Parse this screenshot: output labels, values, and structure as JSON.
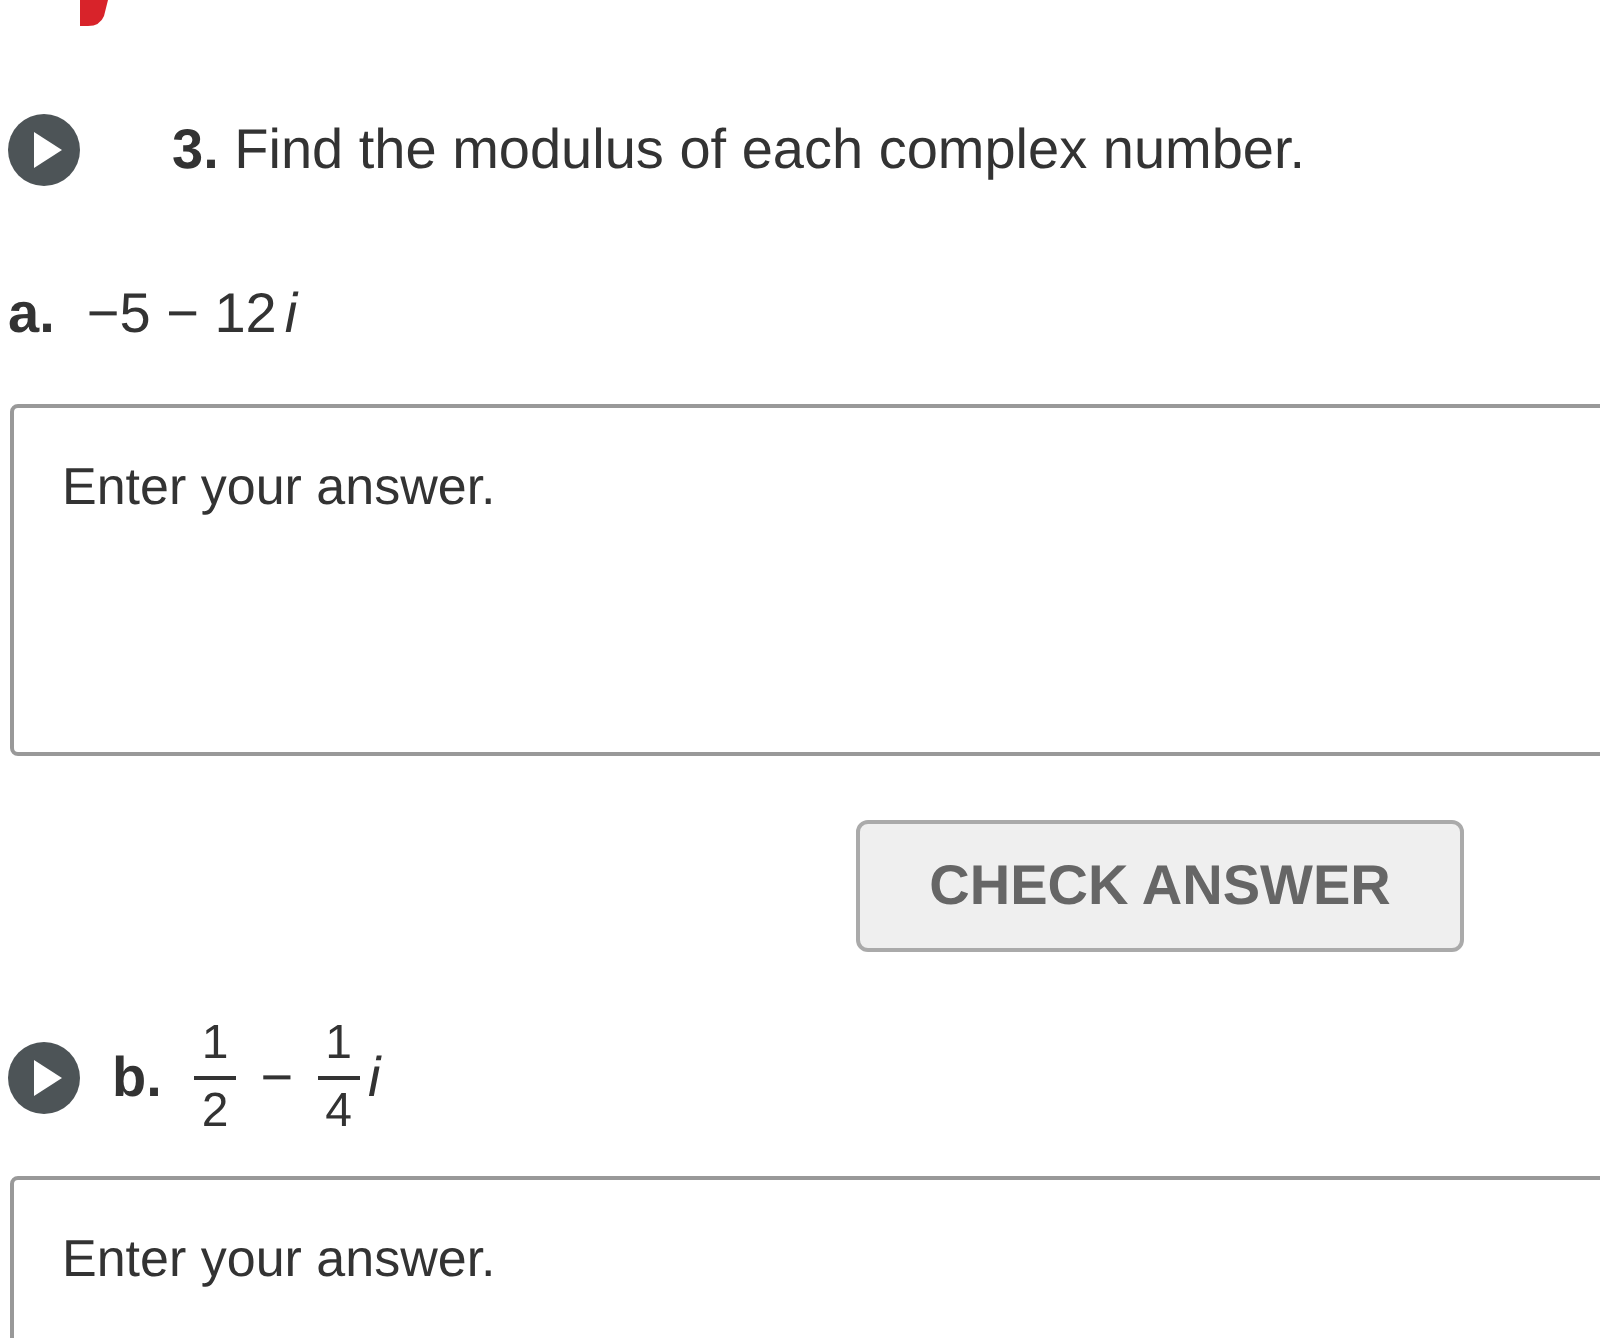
{
  "question": {
    "audio": true,
    "number": "3.",
    "text": "Find the modulus of each complex number."
  },
  "parts": [
    {
      "label": "a.",
      "audio": false,
      "expression": [
        {
          "kind": "text",
          "text": "−5 − 12"
        },
        {
          "kind": "italic",
          "text": "i"
        }
      ],
      "answer": {
        "placeholder": "Enter your answer."
      },
      "button": "CHECK ANSWER"
    },
    {
      "label": "b.",
      "audio": true,
      "expression": [
        {
          "kind": "fraction",
          "numerator": "1",
          "denominator": "2"
        },
        {
          "kind": "text",
          "text": "−"
        },
        {
          "kind": "fraction",
          "numerator": "1",
          "denominator": "4"
        },
        {
          "kind": "italic",
          "text": "i"
        }
      ],
      "answer": {
        "placeholder": "Enter your answer."
      }
    }
  ]
}
